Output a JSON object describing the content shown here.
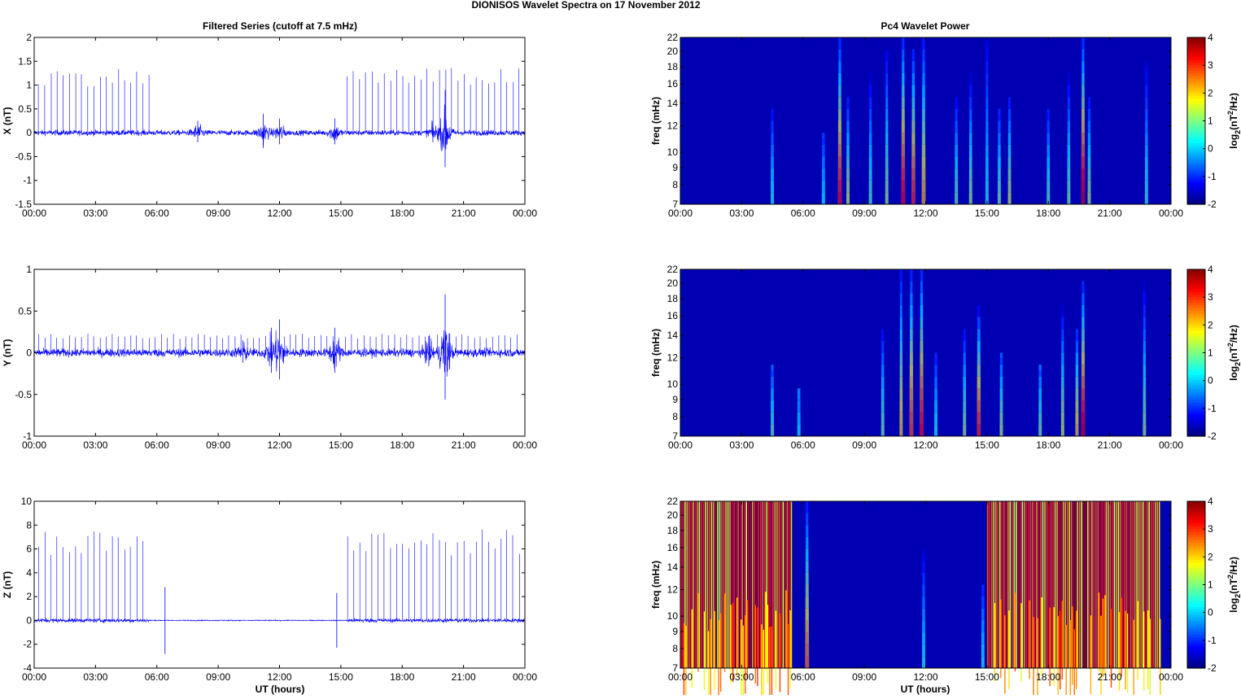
{
  "figure_title": "DIONISOS Wavelet Spectra on 17 November  2012",
  "left_title": "Filtered Series (cutoff at 7.5 mHz)",
  "right_title": "Pc4 Wavelet Power",
  "xlabel": "UT (hours)",
  "xticks": [
    "00:00",
    "03:00",
    "06:00",
    "09:00",
    "12:00",
    "15:00",
    "18:00",
    "21:00",
    "00:00"
  ],
  "colors": {
    "series": "#0000ff",
    "axis": "#000000",
    "background_cmap_low": "#00008f"
  },
  "chart_data": [
    {
      "type": "line",
      "name": "X",
      "ylabel": "X (nT)",
      "xlim": [
        0,
        24
      ],
      "ylim": [
        -1.5,
        2
      ],
      "yticks": [
        "-1.5",
        "-1",
        "-0.5",
        "0",
        "0.5",
        "1",
        "1.5",
        "2"
      ],
      "ytick_values": [
        -1.5,
        -1,
        -0.5,
        0,
        0.5,
        1,
        1.5,
        2
      ],
      "noise_level": 0.04,
      "spike_windows": [
        [
          0.2,
          5.6
        ],
        [
          15.3,
          23.9
        ]
      ],
      "spike_interval_h": 0.3,
      "spike_amplitude": 1.3,
      "bursts": [
        {
          "t": 8.0,
          "amp": 0.25
        },
        {
          "t": 11.2,
          "amp": 0.4
        },
        {
          "t": 12.0,
          "amp": 0.3
        },
        {
          "t": 14.7,
          "amp": 0.3
        },
        {
          "t": 19.5,
          "amp": 0.25
        },
        {
          "t": 20.1,
          "amp": 0.9
        }
      ]
    },
    {
      "type": "heatmap",
      "name": "X wavelet",
      "ylabel": "freq (mHz)",
      "ylim": [
        7,
        22
      ],
      "yscale": "log",
      "yticks": [
        "7",
        "8",
        "9",
        "10",
        "12",
        "14",
        "16",
        "18",
        "20",
        "22"
      ],
      "ytick_values": [
        7,
        8,
        9,
        10,
        12,
        14,
        16,
        18,
        20,
        22
      ],
      "clim": [
        -2,
        4
      ],
      "cticks": [
        "4",
        "3",
        "2",
        "1",
        "0",
        "-1",
        "-2"
      ],
      "clabel": "log2(nT2/Hz)",
      "events": [
        [
          4.5,
          0.5,
          13
        ],
        [
          7.0,
          0.3,
          11
        ],
        [
          7.8,
          3.2,
          22
        ],
        [
          8.2,
          1.5,
          14
        ],
        [
          9.3,
          0.8,
          16
        ],
        [
          10.1,
          1.2,
          20
        ],
        [
          10.9,
          3.3,
          22
        ],
        [
          11.4,
          3.0,
          20
        ],
        [
          11.9,
          2.2,
          22
        ],
        [
          13.5,
          0.9,
          14
        ],
        [
          14.2,
          1.2,
          16
        ],
        [
          15.0,
          0.5,
          22
        ],
        [
          15.6,
          1.0,
          13
        ],
        [
          16.1,
          1.5,
          14
        ],
        [
          18.0,
          0.8,
          13
        ],
        [
          19.0,
          1.0,
          16
        ],
        [
          19.7,
          3.6,
          22
        ],
        [
          20.0,
          1.3,
          14
        ],
        [
          22.8,
          0.6,
          18
        ]
      ]
    },
    {
      "type": "line",
      "name": "Y",
      "ylabel": "Y (nT)",
      "xlim": [
        0,
        24
      ],
      "ylim": [
        -1,
        1
      ],
      "yticks": [
        "-1",
        "-0.5",
        "0",
        "0.5",
        "1"
      ],
      "ytick_values": [
        -1,
        -0.5,
        0,
        0.5,
        1
      ],
      "noise_level": 0.035,
      "spike_windows": [
        [
          0.2,
          23.9
        ]
      ],
      "spike_interval_h": 0.3,
      "spike_amplitude": 0.22,
      "bursts": [
        {
          "t": 10.2,
          "amp": 0.15
        },
        {
          "t": 11.6,
          "amp": 0.3
        },
        {
          "t": 12.0,
          "amp": 0.4
        },
        {
          "t": 14.7,
          "amp": 0.3
        },
        {
          "t": 19.3,
          "amp": 0.2
        },
        {
          "t": 20.1,
          "amp": 0.7
        }
      ]
    },
    {
      "type": "heatmap",
      "name": "Y wavelet",
      "ylabel": "freq (mHz)",
      "ylim": [
        7,
        22
      ],
      "yscale": "log",
      "yticks": [
        "7",
        "8",
        "9",
        "10",
        "12",
        "14",
        "16",
        "18",
        "20",
        "22"
      ],
      "ytick_values": [
        7,
        8,
        9,
        10,
        12,
        14,
        16,
        18,
        20,
        22
      ],
      "clim": [
        -2,
        4
      ],
      "cticks": [
        "4",
        "3",
        "2",
        "1",
        "0",
        "-1",
        "-2"
      ],
      "clabel": "log2(nT2/Hz)",
      "events": [
        [
          4.5,
          0.8,
          11
        ],
        [
          5.8,
          0.3,
          9
        ],
        [
          9.9,
          1.0,
          14
        ],
        [
          10.8,
          2.0,
          22
        ],
        [
          11.3,
          2.8,
          22
        ],
        [
          11.8,
          3.2,
          22
        ],
        [
          12.5,
          0.5,
          12
        ],
        [
          13.9,
          1.2,
          14
        ],
        [
          14.6,
          3.0,
          16
        ],
        [
          15.7,
          1.3,
          12
        ],
        [
          17.6,
          1.0,
          11
        ],
        [
          18.7,
          1.5,
          16
        ],
        [
          19.4,
          2.0,
          14
        ],
        [
          19.7,
          3.5,
          20
        ],
        [
          22.7,
          1.2,
          19
        ]
      ]
    },
    {
      "type": "line",
      "name": "Z",
      "ylabel": "Z (nT)",
      "xlim": [
        0,
        24
      ],
      "ylim": [
        -4,
        10
      ],
      "yticks": [
        "-4",
        "-2",
        "0",
        "2",
        "4",
        "6",
        "8",
        "10"
      ],
      "ytick_values": [
        -4,
        -2,
        0,
        2,
        4,
        6,
        8,
        10
      ],
      "noise_level": 0.12,
      "spike_windows": [
        [
          0.2,
          5.5
        ],
        [
          15.3,
          23.9
        ]
      ],
      "spike_interval_h": 0.3,
      "spike_amplitude": 7.3,
      "bursts": [
        {
          "t": 6.4,
          "amp": -2.8
        },
        {
          "t": 14.8,
          "amp": -2.3
        }
      ]
    },
    {
      "type": "heatmap",
      "name": "Z wavelet",
      "ylabel": "freq (mHz)",
      "ylim": [
        7,
        22
      ],
      "yscale": "log",
      "yticks": [
        "7",
        "8",
        "9",
        "10",
        "12",
        "14",
        "16",
        "18",
        "20",
        "22"
      ],
      "ytick_values": [
        7,
        8,
        9,
        10,
        12,
        14,
        16,
        18,
        20,
        22
      ],
      "clim": [
        -2,
        4
      ],
      "cticks": [
        "4",
        "3",
        "2",
        "1",
        "0",
        "-1",
        "-2"
      ],
      "clabel": "log2(nT2/Hz)",
      "dense_windows": [
        [
          0.0,
          5.4
        ],
        [
          15.0,
          23.5
        ]
      ],
      "events": [
        [
          6.2,
          2.5,
          22
        ],
        [
          11.9,
          0.5,
          15
        ],
        [
          14.8,
          0.5,
          12
        ]
      ]
    }
  ]
}
